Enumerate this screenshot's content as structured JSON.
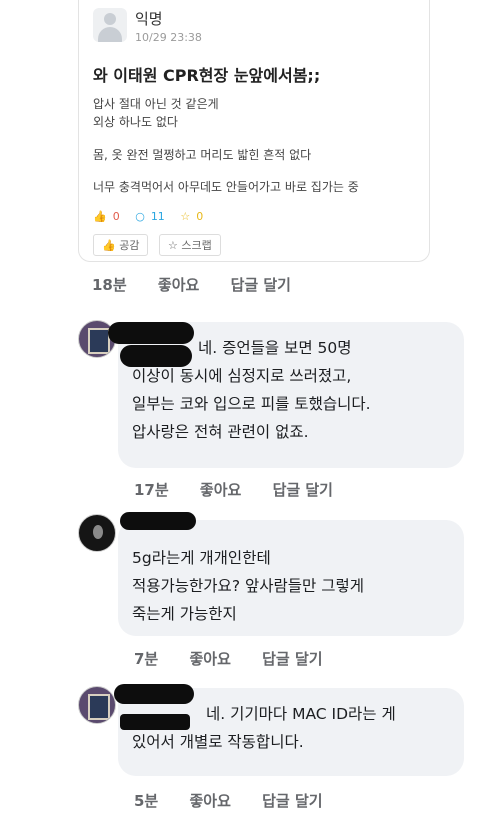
{
  "post": {
    "author": "익명",
    "time": "10/29 23:38",
    "title": "와 이태원 CPR현장 눈앞에서봄;;",
    "lines": [
      "압사 절대 아닌 것 같은게",
      "외상 하나도 없다",
      "몸, 옷 완전 멀쩡하고 머리도 밟힌 흔적 없다",
      "너무 충격먹어서 아무데도 안들어가고 바로 집가는 중"
    ],
    "stats": {
      "likes": "0",
      "comments": "11",
      "scraps": "0"
    },
    "like_button": "공감",
    "scrap_button": "스크랩"
  },
  "post_actions": {
    "time": "18분",
    "like": "좋아요",
    "reply": "답글 달기"
  },
  "comments": [
    {
      "lines": [
        "네. 증언들을 보면 50명",
        "이상이 동시에 심정지로 쓰러졌고,",
        "일부는 코와 입으로 피를 토했습니다.",
        "압사랑은 전혀 관련이 없죠."
      ],
      "time": "17분",
      "like": "좋아요",
      "reply": "답글 달기"
    },
    {
      "lines": [
        "5g라는게 개개인한테",
        "적용가능한가요? 앞사람들만 그렇게",
        "죽는게 가능한지"
      ],
      "time": "7분",
      "like": "좋아요",
      "reply": "답글 달기"
    },
    {
      "lines": [
        "네. 기기마다 MAC ID라는 게",
        "있어서 개별로 작동합니다."
      ],
      "time": "5분",
      "like": "좋아요",
      "reply": "답글 달기"
    }
  ],
  "icons": {
    "like": "thumbs-up-icon",
    "comment": "speech-bubble-icon",
    "scrap": "star-icon"
  },
  "colors": {
    "bubble": "#f0f2f5",
    "action_text": "#65676b"
  }
}
